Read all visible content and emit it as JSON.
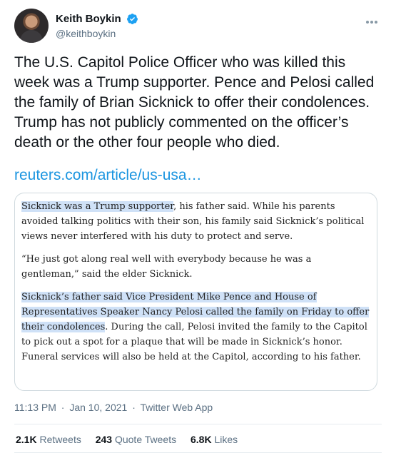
{
  "user": {
    "display_name": "Keith Boykin",
    "handle": "@keithboykin",
    "avatar_icon": "avatar-photo",
    "verified_icon": "verified-badge-icon",
    "verified_color": "#1da1f2"
  },
  "tweet": {
    "text": "The U.S. Capitol Police Officer who was killed this week was a Trump supporter. Pence and Pelosi called the family of Brian Sicknick to offer their condolences. Trump has not publicly commented on the officer’s death or the other four people who died.",
    "link": "reuters.com/article/us-usa…",
    "link_color": "#1b95e0"
  },
  "card": {
    "p1_highlight": "Sicknick was a Trump supporter",
    "p1_rest": ", his father said. While his parents avoided talking politics with their son, his family said Sicknick’s political views never interfered with his duty to protect and serve.",
    "p2": "“He just got along real well with everybody because he was a gentleman,” said the elder Sicknick.",
    "p3_highlight": "Sicknick’s father said Vice President Mike Pence and House of Representatives Speaker Nancy Pelosi called the family on Friday to offer their condolences",
    "p3_rest": ". During the call, Pelosi invited the family to the Capitol to pick out a spot for a plaque that will be made in Sicknick’s honor. Funeral services will also be held at the Capitol, according to his father.",
    "highlight_color": "#cfe1f7"
  },
  "meta": {
    "time": "11:13 PM",
    "sep1": "·",
    "date": "Jan 10, 2021",
    "sep2": "·",
    "source": "Twitter Web App"
  },
  "stats": {
    "retweets_count": "2.1K",
    "retweets_label": "Retweets",
    "quote_count": "243",
    "quote_label": "Quote Tweets",
    "likes_count": "6.8K",
    "likes_label": "Likes"
  },
  "more_icon": "more-options-icon"
}
